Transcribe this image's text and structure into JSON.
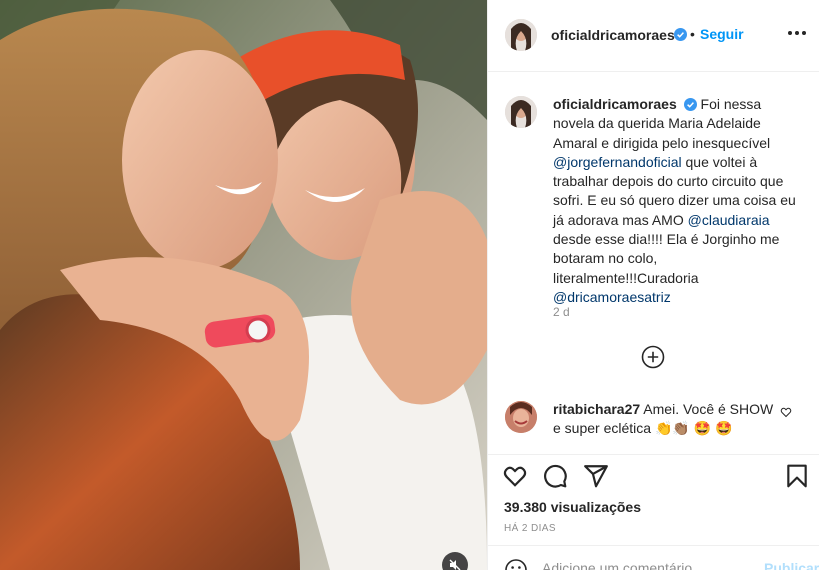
{
  "post": {
    "author": "oficialdricamoraes",
    "follow_label": "Seguir",
    "separator": "•",
    "caption_before_mention1": "Foi nessa novela da querida Maria Adelaide Amaral e dirigida pelo inesquecível ",
    "mention1": "@jorgefernandoficial",
    "caption_mid1": " que voltei à trabalhar depois do curto circuito que sofri. E eu só quero dizer uma coisa eu já adorava mas AMO ",
    "mention2": "@claudiaraia",
    "caption_mid2": " desde esse dia!!!! Ela é Jorginho me botaram no colo, literalmente!!!Curadoria ",
    "mention3": "@dricamoraesatriz",
    "caption_age": "2 d",
    "views": "39.380 visualizações",
    "date": "HÁ 2 DIAS",
    "comment_placeholder": "Adicione um comentário...",
    "publish_label": "Publicar"
  },
  "comments": [
    {
      "author": "ritabichara27",
      "text": "Amei. Você é SHOW e super eclética 👏👏🏽 🤩 🤩"
    }
  ],
  "colors": {
    "accent": "#0095f6",
    "mention": "#00376b",
    "muted": "#8e8e8e",
    "verified": "#3897f0",
    "publish_disabled": "#b2dffc"
  },
  "icons": {
    "like": "heart-icon",
    "comment": "comment-icon",
    "share": "paper-plane-icon",
    "save": "bookmark-icon",
    "load_more": "plus-circle-icon",
    "mute": "speaker-muted-icon",
    "options": "more-options-icon",
    "emoji": "smiley-icon"
  }
}
